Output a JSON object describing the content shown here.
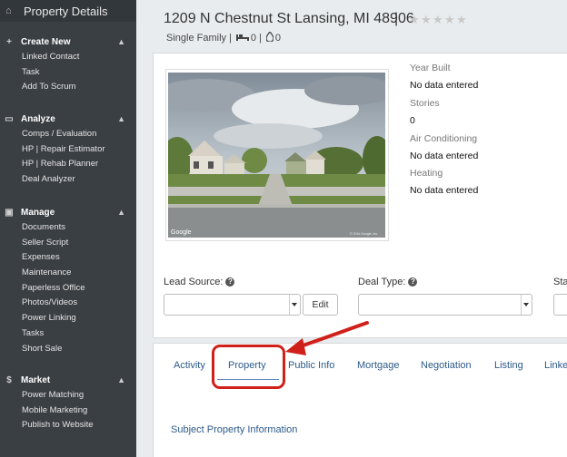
{
  "sidebar": {
    "title": "Property Details",
    "sections": [
      {
        "name": "create-new",
        "icon": "plus-icon",
        "glyph": "+",
        "label": "Create New",
        "items": [
          "Linked Contact",
          "Task",
          "Add To Scrum"
        ]
      },
      {
        "name": "analyze",
        "icon": "laptop-icon",
        "glyph": "▭",
        "label": "Analyze",
        "items": [
          "Comps / Evaluation",
          "HP | Repair Estimator",
          "HP | Rehab Planner",
          "Deal Analyzer"
        ]
      },
      {
        "name": "manage",
        "icon": "briefcase-icon",
        "glyph": "▣",
        "label": "Manage",
        "items": [
          "Documents",
          "Seller Script",
          "Expenses",
          "Maintenance",
          "Paperless Office",
          "Photos/Videos",
          "Power Linking",
          "Tasks",
          "Short Sale"
        ]
      },
      {
        "name": "market",
        "icon": "dollar-icon",
        "glyph": "$",
        "label": "Market",
        "items": [
          "Power Matching",
          "Mobile Marketing",
          "Publish to Website"
        ]
      }
    ]
  },
  "header": {
    "address": "1209 N Chestnut St Lansing, MI 48906",
    "separator": "|",
    "rating": 0,
    "rating_max": 5,
    "property_type": "Single Family",
    "beds": "0",
    "baths": "0"
  },
  "details": [
    {
      "label": "Year Built",
      "value": "No data entered"
    },
    {
      "label": "Stories",
      "value": "0"
    },
    {
      "label": "Air Conditioning",
      "value": "No data entered"
    },
    {
      "label": "Heating",
      "value": "No data entered"
    }
  ],
  "photo": {
    "watermark": "Google",
    "copyright": "© 2016 Google, Inc."
  },
  "fields": {
    "lead_source_label": "Lead Source:",
    "lead_source_value": "",
    "edit_label": "Edit",
    "deal_type_label": "Deal Type:",
    "deal_type_value": "",
    "status_label": "Sta"
  },
  "tabs": [
    "Activity",
    "Property",
    "Public Info",
    "Mortgage",
    "Negotiation",
    "Listing",
    "Linke"
  ],
  "active_tab": "Property",
  "section_link": "Subject Property Information",
  "colors": {
    "sidebar": "#3a3f44",
    "link": "#2c5a8a",
    "annotation": "#d0201a"
  }
}
